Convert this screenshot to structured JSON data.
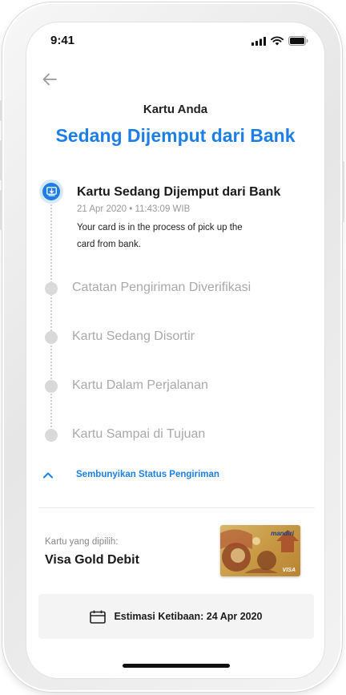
{
  "status_bar": {
    "time": "9:41",
    "icons": [
      "cellular-signal-icon",
      "wifi-icon",
      "battery-icon"
    ]
  },
  "header": {
    "subtitle": "Kartu Anda",
    "title": "Sedang Dijemput dari Bank"
  },
  "timeline": {
    "active_step": {
      "title": "Kartu Sedang Dijemput dari Bank",
      "date": "21 Apr 2020 • 11:43:09 WIB",
      "description": "Your card is in the process of pick up the card from bank."
    },
    "pending_steps": [
      {
        "label": "Catatan Pengiriman Diverifikasi"
      },
      {
        "label": "Kartu Sedang Disortir"
      },
      {
        "label": "Kartu Dalam Perjalanan"
      },
      {
        "label": "Kartu Sampai di Tujuan"
      }
    ],
    "toggle_label": "Sembunyikan Status Pengiriman"
  },
  "card": {
    "caption": "Kartu yang dipilih:",
    "name": "Visa Gold Debit",
    "image_brand": "mandiri",
    "image_network": "VISA"
  },
  "estimate": {
    "label": "Estimasi Ketibaan: 24 Apr 2020"
  },
  "colors": {
    "accent": "#1d7fe6",
    "pending": "#d9d9d9",
    "pending_text": "#a9a9a9"
  }
}
